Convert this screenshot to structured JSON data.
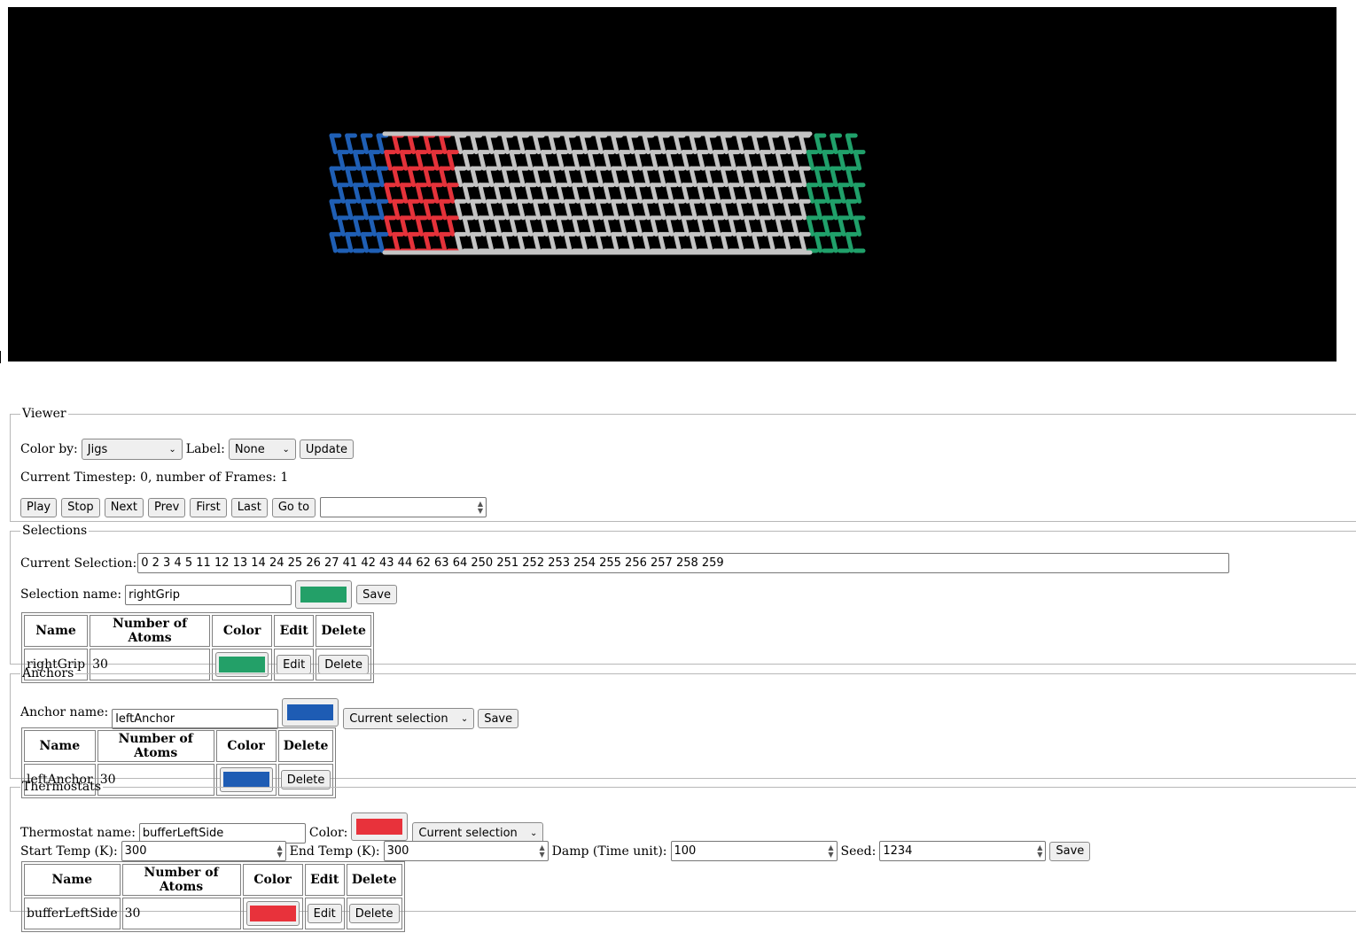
{
  "viewer": {
    "legend": "Viewer",
    "color_by_label": "Color by:",
    "color_by_value": "Jigs",
    "label_label": "Label:",
    "label_value": "None",
    "update_label": "Update",
    "status": "Current Timestep: 0, number of Frames: 1",
    "buttons": {
      "play": "Play",
      "stop": "Stop",
      "next": "Next",
      "prev": "Prev",
      "first": "First",
      "last": "Last",
      "goto": "Go to"
    },
    "goto_value": ""
  },
  "molecule": {
    "colors": {
      "background": "#000000",
      "default": "#c4c4c4",
      "anchor": "#1f5fb5",
      "thermostat": "#e5323a",
      "grip": "#20a06a"
    }
  },
  "selections": {
    "legend": "Selections",
    "current_label": "Current Selection:",
    "current_value": "0 2 3 4 5 11 12 13 14 24 25 26 27 41 42 43 44 62 63 64 250 251 252 253 254 255 256 257 258 259",
    "name_label": "Selection name:",
    "name_value": "rightGrip",
    "color": "#23a068",
    "save_label": "Save",
    "table_headers": [
      "Name",
      "Number of Atoms",
      "Color",
      "Edit",
      "Delete"
    ],
    "rows": [
      {
        "name": "rightGrip",
        "atoms": "30",
        "color": "#23a068",
        "edit": "Edit",
        "delete": "Delete"
      }
    ]
  },
  "anchors": {
    "legend": "Anchors",
    "name_label": "Anchor name:",
    "name_value": "leftAnchor",
    "color": "#1e5cb4",
    "source_value": "Current selection",
    "save_label": "Save",
    "table_headers": [
      "Name",
      "Number of Atoms",
      "Color",
      "Delete"
    ],
    "rows": [
      {
        "name": "leftAnchor",
        "atoms": "30",
        "color": "#1e5cb4",
        "delete": "Delete"
      }
    ]
  },
  "thermostats": {
    "legend": "Thermostats",
    "name_label": "Thermostat name:",
    "name_value": "bufferLeftSide",
    "color_label": "Color:",
    "color": "#e8323b",
    "source_value": "Current selection",
    "start_temp_label": "Start Temp (K):",
    "start_temp_value": "300",
    "end_temp_label": "End Temp (K):",
    "end_temp_value": "300",
    "damp_label": "Damp (Time unit):",
    "damp_value": "100",
    "seed_label": "Seed:",
    "seed_value": "1234",
    "save_label": "Save",
    "table_headers": [
      "Name",
      "Number of Atoms",
      "Color",
      "Edit",
      "Delete"
    ],
    "rows": [
      {
        "name": "bufferLeftSide",
        "atoms": "30",
        "color": "#e8323b",
        "edit": "Edit",
        "delete": "Delete"
      }
    ]
  }
}
